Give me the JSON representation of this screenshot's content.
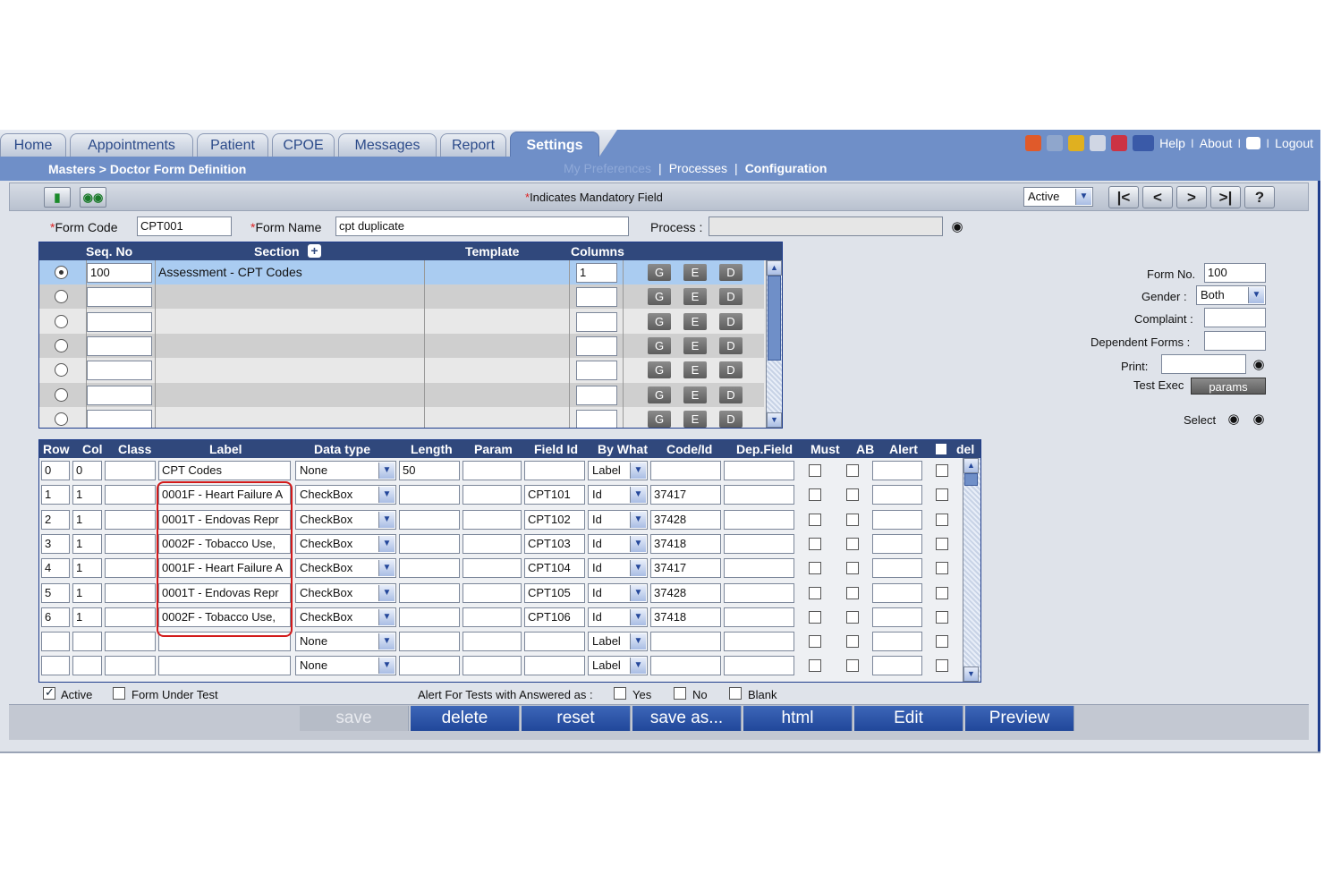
{
  "tabs": [
    {
      "label": "Home"
    },
    {
      "label": "Appointments"
    },
    {
      "label": "Patient"
    },
    {
      "label": "CPOE"
    },
    {
      "label": "Messages"
    },
    {
      "label": "Report"
    },
    {
      "label": "Settings"
    }
  ],
  "topright": {
    "help": "Help",
    "about": "About",
    "logout": "Logout",
    "sep": "I"
  },
  "breadcrumb": "Masters > Doctor Form Definition",
  "sublinks": {
    "my_prefs": "My Preferences",
    "processes": "Processes",
    "configuration": "Configuration",
    "sep": "|"
  },
  "toolbar": {
    "mandatory_star": "*",
    "mandatory_text": "Indicates Mandatory Field",
    "status": "Active",
    "nav": [
      "|<",
      "<",
      ">",
      ">|",
      "?"
    ]
  },
  "form": {
    "star": "*",
    "form_code_label": "Form Code",
    "form_code": "CPT001",
    "form_name_label": "Form Name",
    "form_name": "cpt duplicate",
    "process_label": "Process :",
    "process": ""
  },
  "sections_grid": {
    "headers": {
      "seq": "Seq. No",
      "section": "Section",
      "template": "Template",
      "columns": "Columns"
    },
    "buttons": {
      "g": "G",
      "e": "E",
      "d": "D"
    },
    "rows": [
      {
        "seq": "100",
        "section": "Assessment - CPT Codes",
        "columns": "1"
      },
      {
        "seq": "",
        "section": "",
        "columns": ""
      },
      {
        "seq": "",
        "section": "",
        "columns": ""
      },
      {
        "seq": "",
        "section": "",
        "columns": ""
      },
      {
        "seq": "",
        "section": "",
        "columns": ""
      },
      {
        "seq": "",
        "section": "",
        "columns": ""
      },
      {
        "seq": "",
        "section": "",
        "columns": ""
      }
    ]
  },
  "right_panel": {
    "form_no_label": "Form No.",
    "form_no": "100",
    "gender_label": "Gender :",
    "gender": "Both",
    "complaint_label": "Complaint :",
    "dependent_label": "Dependent Forms :",
    "print_label": "Print:",
    "test_exec_label": "Test Exec",
    "params_label": "params",
    "select_label": "Select"
  },
  "fields_grid": {
    "headers": {
      "row": "Row",
      "col": "Col",
      "class": "Class",
      "label": "Label",
      "datatype": "Data type",
      "length": "Length",
      "param": "Param",
      "fieldid": "Field Id",
      "bywhat": "By What",
      "codeid": "Code/Id",
      "depfield": "Dep.Field",
      "must": "Must",
      "ab": "AB",
      "alert": "Alert",
      "del": "del"
    },
    "rows": [
      {
        "row": "0",
        "col": "0",
        "label": "CPT Codes",
        "datatype": "None",
        "length": "50",
        "fieldid": "",
        "bywhat": "Label",
        "codeid": ""
      },
      {
        "row": "1",
        "col": "1",
        "label": "0001F - Heart Failure A",
        "datatype": "CheckBox",
        "length": "",
        "fieldid": "CPT101",
        "bywhat": "Id",
        "codeid": "37417"
      },
      {
        "row": "2",
        "col": "1",
        "label": "0001T - Endovas Repr",
        "datatype": "CheckBox",
        "length": "",
        "fieldid": "CPT102",
        "bywhat": "Id",
        "codeid": "37428"
      },
      {
        "row": "3",
        "col": "1",
        "label": "0002F - Tobacco Use,",
        "datatype": "CheckBox",
        "length": "",
        "fieldid": "CPT103",
        "bywhat": "Id",
        "codeid": "37418"
      },
      {
        "row": "4",
        "col": "1",
        "label": "0001F - Heart Failure A",
        "datatype": "CheckBox",
        "length": "",
        "fieldid": "CPT104",
        "bywhat": "Id",
        "codeid": "37417"
      },
      {
        "row": "5",
        "col": "1",
        "label": "0001T - Endovas Repr",
        "datatype": "CheckBox",
        "length": "",
        "fieldid": "CPT105",
        "bywhat": "Id",
        "codeid": "37428"
      },
      {
        "row": "6",
        "col": "1",
        "label": "0002F - Tobacco Use,",
        "datatype": "CheckBox",
        "length": "",
        "fieldid": "CPT106",
        "bywhat": "Id",
        "codeid": "37418"
      },
      {
        "row": "",
        "col": "",
        "label": "",
        "datatype": "None",
        "length": "",
        "fieldid": "",
        "bywhat": "Label",
        "codeid": ""
      },
      {
        "row": "",
        "col": "",
        "label": "",
        "datatype": "None",
        "length": "",
        "fieldid": "",
        "bywhat": "Label",
        "codeid": ""
      }
    ]
  },
  "bottom": {
    "active_label": "Active",
    "active_checked": true,
    "form_under_test_label": "Form Under Test",
    "alert_label": "Alert For Tests with Answered as :",
    "yes_label": "Yes",
    "no_label": "No",
    "blank_label": "Blank"
  },
  "actions": [
    "save",
    "delete",
    "reset",
    "save as...",
    "html",
    "Edit",
    "Preview"
  ],
  "colors": {
    "brand": "#6f8fc8",
    "header": "#30487c",
    "button": "#2a4fa3",
    "highlight": "#d21a1a"
  }
}
